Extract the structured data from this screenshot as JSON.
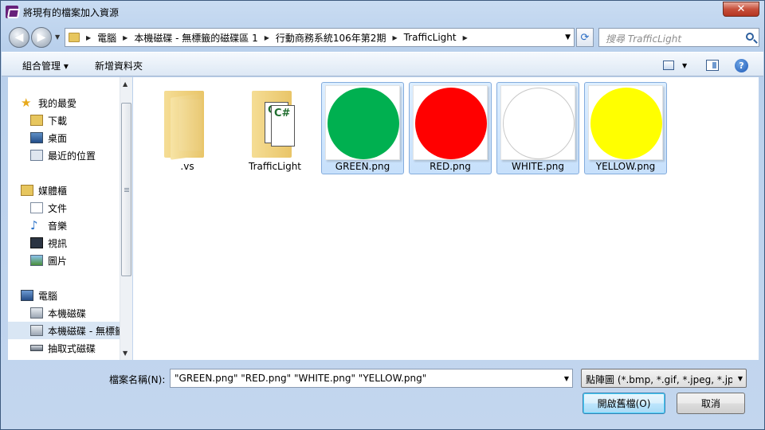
{
  "window": {
    "title": "將現有的檔案加入資源"
  },
  "titlebar": {
    "close_glyph": "✕"
  },
  "nav": {
    "breadcrumbs": [
      "電腦",
      "本機磁碟 - 無標籤的磁碟區 1",
      "行動商務系統106年第2期",
      "TrafficLight"
    ],
    "search_placeholder": "搜尋 TrafficLight"
  },
  "toolbar": {
    "organize_label": "組合管理 ▾",
    "newfolder_label": "新增資料夾"
  },
  "sidebar": {
    "items": [
      {
        "label": "我的最愛",
        "icon": "star-icon"
      },
      {
        "label": "下載",
        "icon": "downloads-icon"
      },
      {
        "label": "桌面",
        "icon": "desktop-icon"
      },
      {
        "label": "最近的位置",
        "icon": "recent-places-icon"
      },
      {
        "label": "媒體櫃",
        "icon": "libraries-icon"
      },
      {
        "label": "文件",
        "icon": "documents-icon"
      },
      {
        "label": "音樂",
        "icon": "music-icon"
      },
      {
        "label": "視訊",
        "icon": "videos-icon"
      },
      {
        "label": "圖片",
        "icon": "pictures-icon"
      },
      {
        "label": "電腦",
        "icon": "computer-icon"
      },
      {
        "label": "本機磁碟",
        "icon": "local-disk-icon"
      },
      {
        "label": "本機磁碟 - 無標籤",
        "icon": "local-disk-icon",
        "selected": true
      },
      {
        "label": "抽取式磁碟",
        "icon": "removable-disk-icon"
      }
    ]
  },
  "files": [
    {
      "name": ".vs",
      "kind": "folder"
    },
    {
      "name": "TrafficLight",
      "kind": "cs-folder"
    },
    {
      "name": "GREEN.png",
      "kind": "image",
      "color": "#00b050"
    },
    {
      "name": "RED.png",
      "kind": "image",
      "color": "#ff0000"
    },
    {
      "name": "WHITE.png",
      "kind": "image",
      "color": "#ffffff"
    },
    {
      "name": "YELLOW.png",
      "kind": "image",
      "color": "#ffff00"
    }
  ],
  "bottom": {
    "filename_label": "檔案名稱(N):",
    "filename_value": "\"GREEN.png\" \"RED.png\" \"WHITE.png\" \"YELLOW.png\"",
    "filetype_value": "點陣圖 (*.bmp, *.gif, *.jpeg, *.jpg,",
    "open_label": "開啟舊檔(O)",
    "cancel_label": "取消"
  }
}
